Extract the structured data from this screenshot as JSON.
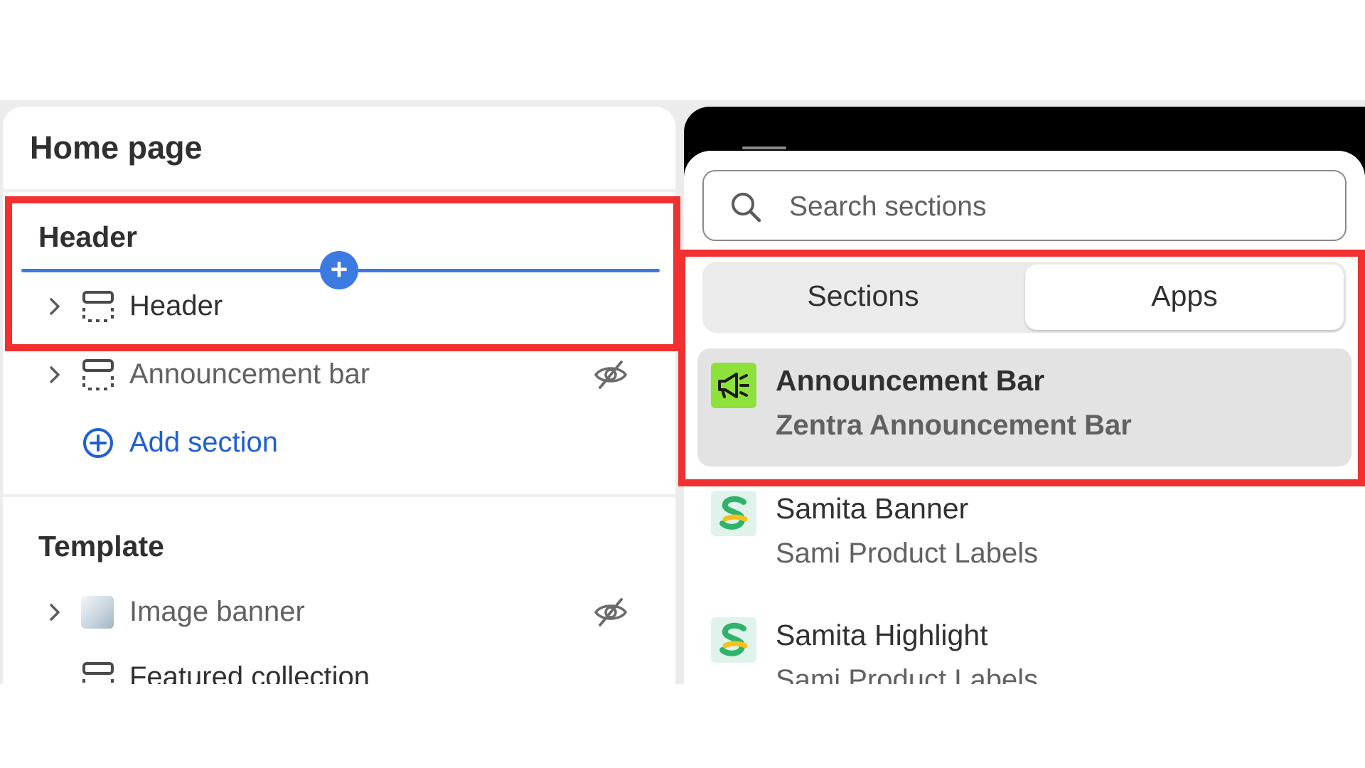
{
  "left_panel": {
    "title": "Home page",
    "header_group": {
      "title": "Header",
      "add_here_symbol": "+",
      "items": [
        {
          "label": "Header",
          "icon": "section-layout-icon",
          "hidden": false
        },
        {
          "label": "Announcement bar",
          "icon": "section-layout-icon",
          "hidden": true
        }
      ],
      "add_section_label": "Add section"
    },
    "template_group": {
      "title": "Template",
      "items": [
        {
          "label": "Image banner",
          "icon": "image-thumbnail",
          "hidden": true
        },
        {
          "label": "Featured collection",
          "icon": "section-layout-icon",
          "hidden": false
        }
      ]
    }
  },
  "picker": {
    "search_placeholder": "Search sections",
    "tabs": [
      {
        "label": "Sections",
        "selected": false
      },
      {
        "label": "Apps",
        "selected": true
      }
    ],
    "apps": [
      {
        "name": "Announcement Bar",
        "provider": "Zentra Announcement Bar",
        "logo": "megaphone-icon",
        "highlighted": true
      },
      {
        "name": "Samita Banner",
        "provider": "Sami Product Labels",
        "logo": "samita-logo-icon",
        "highlighted": false
      },
      {
        "name": "Samita Highlight",
        "provider": "Sami Product Labels",
        "logo": "samita-logo-icon",
        "highlighted": false
      }
    ]
  },
  "colors": {
    "accent_blue": "#3b7ae0",
    "link_blue": "#1f5fd6",
    "annotation_red": "#f23030",
    "megaphone_bg": "#8ee13b",
    "samita_bg": "#dff3ea"
  }
}
